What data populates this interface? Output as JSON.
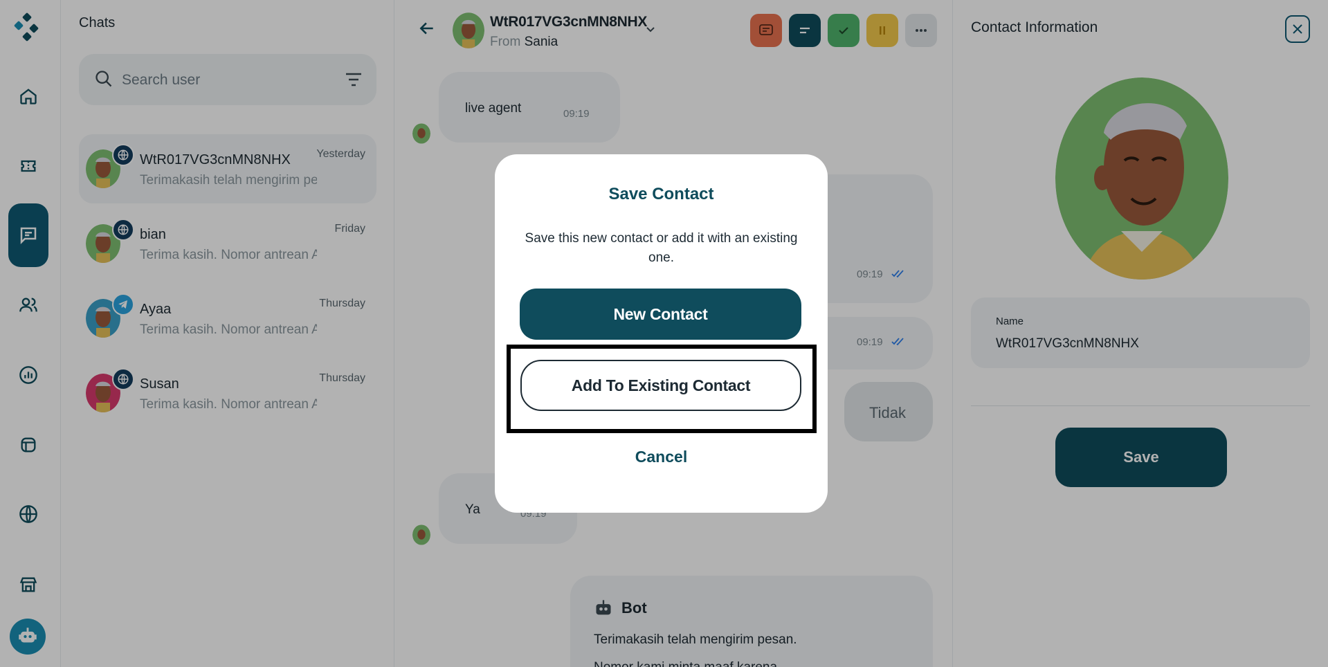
{
  "sidebar": {
    "items": [
      {
        "icon": "home-icon"
      },
      {
        "icon": "ticket-icon"
      },
      {
        "icon": "chat-icon",
        "active": true
      },
      {
        "icon": "users-icon"
      },
      {
        "icon": "analytics-icon"
      },
      {
        "icon": "layout-icon"
      },
      {
        "icon": "globe-icon"
      },
      {
        "icon": "store-icon"
      }
    ]
  },
  "chat_list": {
    "title": "Chats",
    "search_placeholder": "Search user",
    "items": [
      {
        "name": "WtR017VG3cnMN8NHX",
        "time": "Yesterday",
        "preview": "Terimakasih telah mengirim pesan.",
        "channel": "web-channel-icon",
        "selected": true
      },
      {
        "name": "bian",
        "time": "Friday",
        "preview": "Terima kasih. Nomor antrean Anda",
        "channel": "web-channel-icon"
      },
      {
        "name": "Ayaa",
        "time": "Thursday",
        "preview": "Terima kasih. Nomor antrean Anda",
        "channel": "telegram-icon"
      },
      {
        "name": "Susan",
        "time": "Thursday",
        "preview": "Terima kasih. Nomor antrean Anda",
        "channel": "web-channel-icon"
      }
    ]
  },
  "conversation": {
    "contact_name": "WtR017VG3cnMN8NHX",
    "from_label": "From",
    "from_agent": "Sania",
    "messages": [
      {
        "text": "live agent",
        "time": "09:19"
      },
      {
        "text": "",
        "time": "09:19"
      },
      {
        "text": "",
        "time": "09:19"
      },
      {
        "text": "Tidak",
        "time": ""
      },
      {
        "text": "Ya",
        "time": "09:19"
      }
    ],
    "bot_label": "Bot",
    "bot_message": "Terimakasih telah mengirim pesan.",
    "bot_message_2": "Nomor kami minta maaf karena ...",
    "toolbar": {
      "colors": {
        "transcript": "#e8714f",
        "notes": "#0f4c5c",
        "resolve": "#4fb36c",
        "pause": "#f2c94c",
        "more": "#e3e7ea"
      }
    }
  },
  "contact_info": {
    "title": "Contact Information",
    "name_label": "Name",
    "name_value": "WtR017VG3cnMN8NHX",
    "save_label": "Save"
  },
  "modal": {
    "title": "Save Contact",
    "description": "Save this new contact or add it with an existing one.",
    "new_contact_label": "New Contact",
    "add_existing_label": "Add To Existing Contact",
    "cancel_label": "Cancel"
  }
}
